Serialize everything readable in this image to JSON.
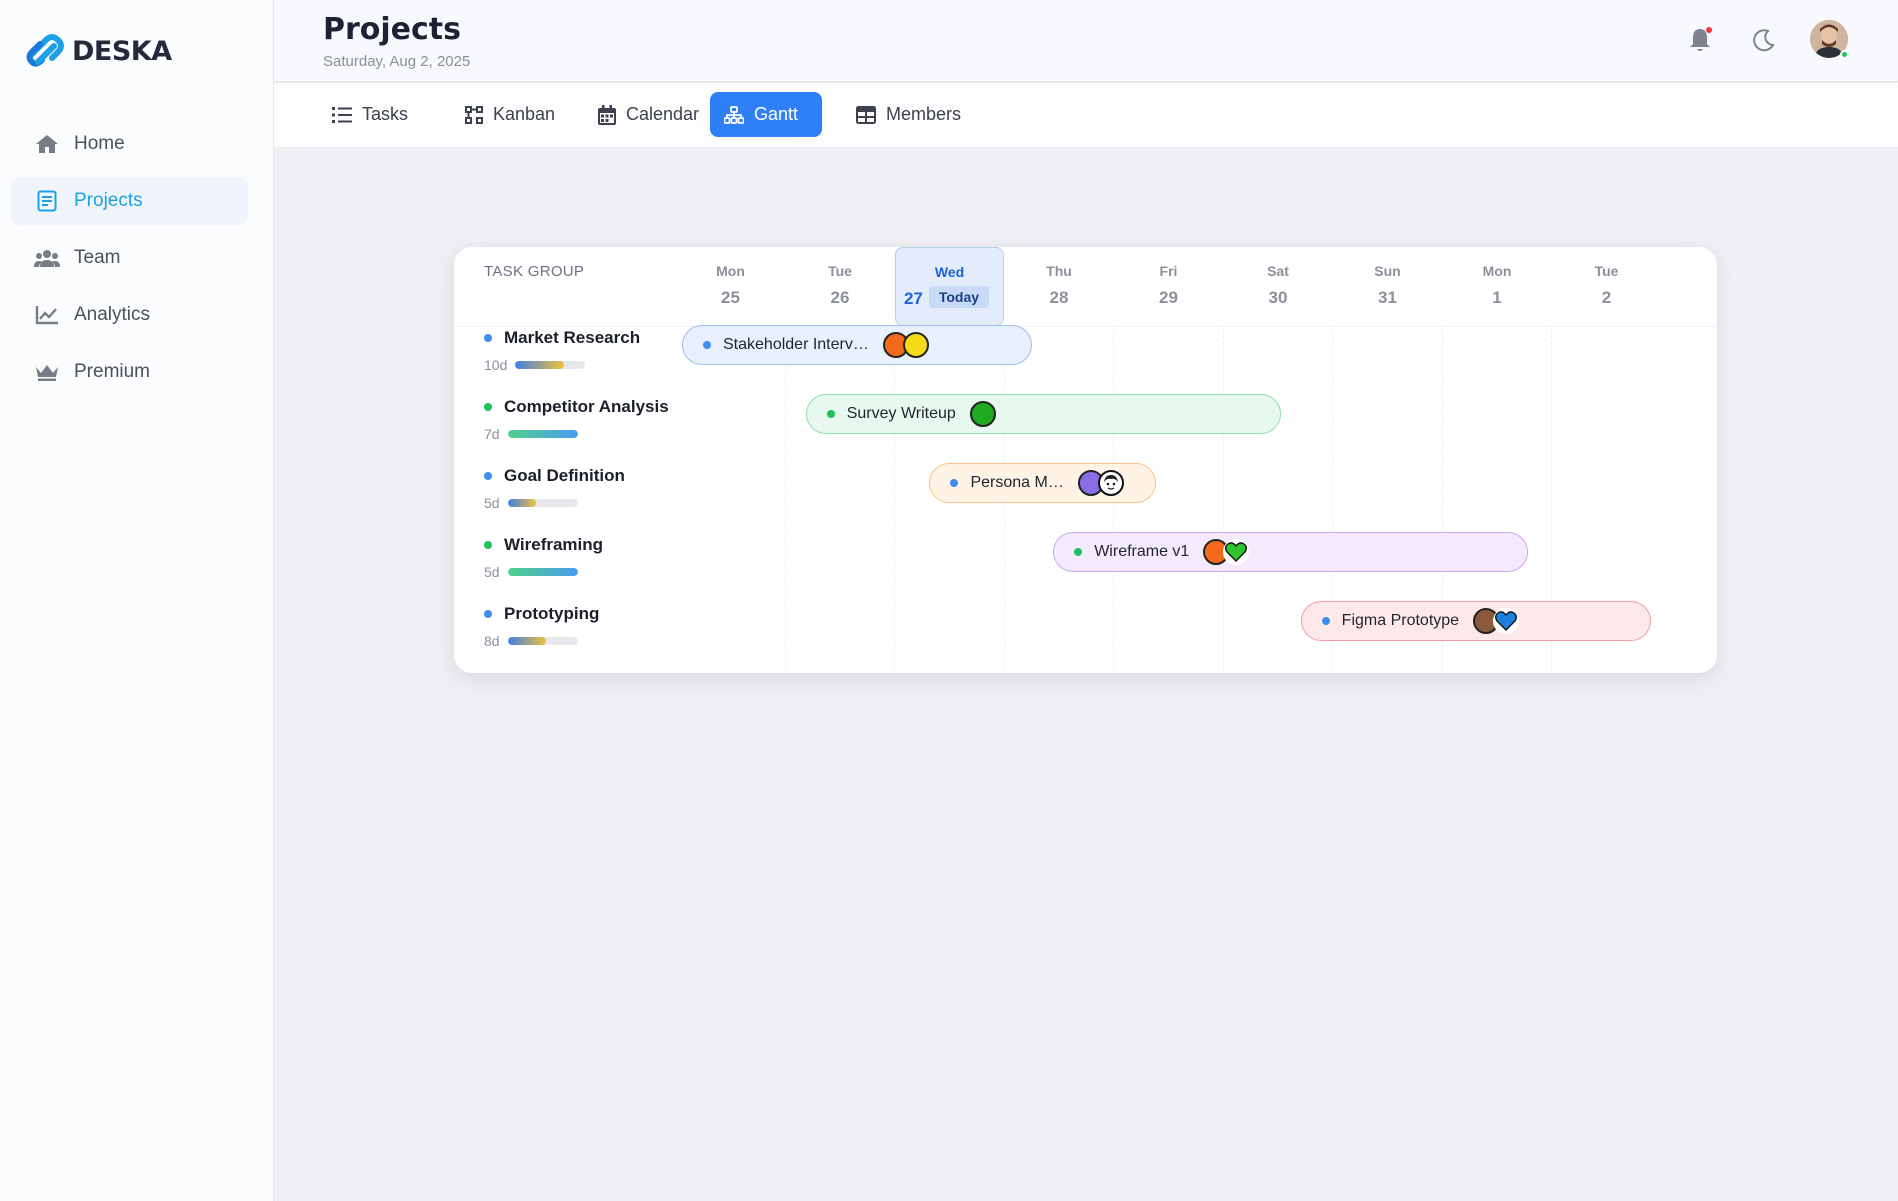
{
  "app": {
    "logo_text": "DESKA"
  },
  "sidebar": {
    "items": [
      {
        "label": "Home",
        "icon": "home-icon",
        "active": false
      },
      {
        "label": "Projects",
        "icon": "document-icon",
        "active": true
      },
      {
        "label": "Team",
        "icon": "users-icon",
        "active": false
      },
      {
        "label": "Analytics",
        "icon": "chart-line-icon",
        "active": false
      },
      {
        "label": "Premium",
        "icon": "crown-icon",
        "active": false
      }
    ]
  },
  "header": {
    "title": "Projects",
    "date": "Saturday, Aug 2, 2025",
    "icons": [
      "bell-icon",
      "moon-icon"
    ]
  },
  "tabs": [
    {
      "label": "Tasks",
      "icon": "list-icon",
      "active": false
    },
    {
      "label": "Kanban",
      "icon": "kanban-icon",
      "active": false
    },
    {
      "label": "Calendar",
      "icon": "calendar-icon",
      "active": false
    },
    {
      "label": "Gantt",
      "icon": "gantt-icon",
      "active": true
    },
    {
      "label": "Members",
      "icon": "table-icon",
      "active": false
    }
  ],
  "gantt": {
    "column_label": "TASK GROUP",
    "today_badge": "Today",
    "days": [
      {
        "name": "Mon",
        "date": "25"
      },
      {
        "name": "Tue",
        "date": "26"
      },
      {
        "name": "Wed",
        "date": "27",
        "today": true
      },
      {
        "name": "Thu",
        "date": "28"
      },
      {
        "name": "Fri",
        "date": "29"
      },
      {
        "name": "Sat",
        "date": "30"
      },
      {
        "name": "Sun",
        "date": "31"
      },
      {
        "name": "Mon",
        "date": "1"
      },
      {
        "name": "Tue",
        "date": "2"
      }
    ],
    "groups": [
      {
        "name": "Market Research",
        "duration": "10d",
        "dot_color": "#3b8df0",
        "progress": 0.7,
        "task": {
          "label": "Stakeholder Interv…",
          "dot_color": "#3b8df0",
          "start_day": 0,
          "span_days": 3.2,
          "bg": "#e9f0fd",
          "border": "#9ebdf2",
          "avatars": [
            {
              "color": "#f26a1b",
              "icon": "avatar-orange-icon"
            },
            {
              "color": "#f6dc18",
              "icon": "avatar-yellow-icon"
            }
          ]
        }
      },
      {
        "name": "Competitor Analysis",
        "duration": "7d",
        "dot_color": "#1fc25a",
        "progress": 1.0,
        "task": {
          "label": "Survey Writeup",
          "dot_color": "#1fc25a",
          "start_day": 1.13,
          "span_days": 4.34,
          "bg": "#e7f8ee",
          "border": "#8fe0ac",
          "avatars": [
            {
              "color": "#1faa1f",
              "icon": "avatar-green-icon"
            }
          ]
        }
      },
      {
        "name": "Goal Definition",
        "duration": "5d",
        "dot_color": "#3b8df0",
        "progress": 0.4,
        "task": {
          "label": "Persona M…",
          "dot_color": "#3b8df0",
          "start_day": 2.26,
          "span_days": 2.07,
          "bg": "#fff3e6",
          "border": "#f7c38d",
          "avatars": [
            {
              "color": "#8a6ee8",
              "icon": "avatar-purple-icon"
            },
            {
              "color": "#ffffff",
              "icon": "avatar-face-icon"
            }
          ]
        }
      },
      {
        "name": "Wireframing",
        "duration": "5d",
        "dot_color": "#1fc25a",
        "progress": 1.0,
        "task": {
          "label": "Wireframe v1",
          "dot_color": "#1fc25a",
          "start_day": 3.39,
          "span_days": 4.34,
          "bg": "#f3ebfd",
          "border": "#c9a9f1",
          "avatars": [
            {
              "color": "#f26a1b",
              "icon": "avatar-orange-icon"
            },
            {
              "color": "#2fc42f",
              "icon": "heart-green-icon"
            }
          ]
        }
      },
      {
        "name": "Prototyping",
        "duration": "8d",
        "dot_color": "#3b8df0",
        "progress": 0.55,
        "task": {
          "label": "Figma Prototype",
          "dot_color": "#3b8df0",
          "start_day": 5.65,
          "span_days": 3.2,
          "bg": "#fde9ea",
          "border": "#f19da3",
          "avatars": [
            {
              "color": "#8a5a3a",
              "icon": "avatar-brown-icon"
            },
            {
              "color": "#1d7fe0",
              "icon": "heart-blue-icon"
            }
          ]
        }
      }
    ]
  },
  "colors": {
    "accent": "#2f80f6",
    "active_nav": "#1aa3e0"
  }
}
